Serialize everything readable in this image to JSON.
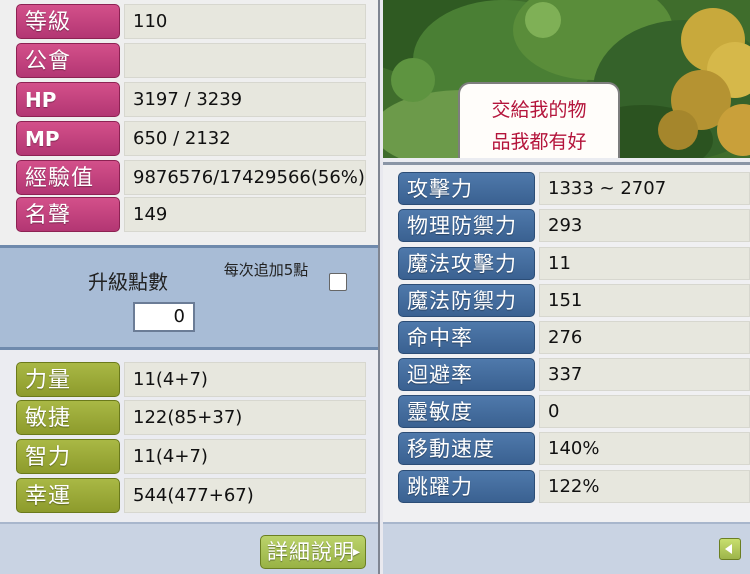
{
  "left": {
    "info_rows": [
      {
        "label": "等級",
        "value": "110"
      },
      {
        "label": "公會",
        "value": ""
      },
      {
        "label": "HP",
        "value": "3197 / 3239"
      },
      {
        "label": "MP",
        "value": "650 / 2132"
      },
      {
        "label": "經驗值",
        "value": "9876576/17429566(56%)"
      },
      {
        "label": "名聲",
        "value": "149"
      }
    ],
    "ap_section": {
      "title": "升級點數",
      "points": "0",
      "auto_label": "每次追加5點"
    },
    "base_stats": [
      {
        "label": "力量",
        "value": "11(4+7)"
      },
      {
        "label": "敏捷",
        "value": "122(85+37)"
      },
      {
        "label": "智力",
        "value": "11(4+7)"
      },
      {
        "label": "幸運",
        "value": "544(477+67)"
      }
    ],
    "detail_button": "詳細說明"
  },
  "right": {
    "npc_bubble": [
      "交給我的物",
      "品我都有好"
    ],
    "detail_stats": [
      {
        "label": "攻擊力",
        "value": "1333 ~ 2707"
      },
      {
        "label": "物理防禦力",
        "value": "293"
      },
      {
        "label": "魔法攻擊力",
        "value": "11"
      },
      {
        "label": "魔法防禦力",
        "value": "151"
      },
      {
        "label": "命中率",
        "value": "276"
      },
      {
        "label": "迴避率",
        "value": "337"
      },
      {
        "label": "靈敏度",
        "value": "0"
      },
      {
        "label": "移動速度",
        "value": "140%"
      },
      {
        "label": "跳躍力",
        "value": "122%"
      }
    ]
  },
  "colors": {
    "info_label": "#c0417c",
    "stat_label": "#9cab38",
    "detail_label": "#4a72a4",
    "ap_box": "#a8bcd6",
    "bubble_text": "#b4143b"
  },
  "icons": {
    "detail_button_arrow": "chevron-right-icon",
    "back_button": "arrow-left-icon",
    "auto_assign": "checkbox-icon"
  }
}
